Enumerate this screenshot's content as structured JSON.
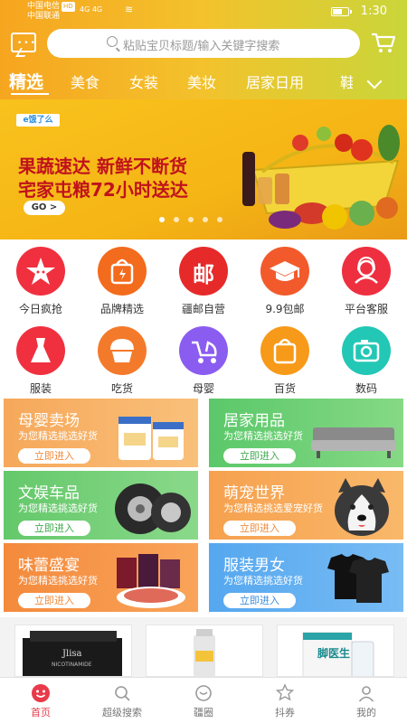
{
  "status": {
    "carrier1": "中国电信",
    "carrier1_badge": "HD",
    "carrier2": "中国联通",
    "signal": "4G 4G",
    "wifi": "≋",
    "time": "1:30"
  },
  "search": {
    "placeholder": "粘贴宝贝标题/输入关键字搜索"
  },
  "categories": [
    "精选",
    "美食",
    "女装",
    "美妆",
    "居家日用",
    "鞋"
  ],
  "banner": {
    "brand": "e饿了么",
    "headline1": "果蔬速达  新鲜不断货",
    "headline2": "宅家屯粮72小时送达",
    "button": "GO >",
    "dots": 5,
    "active_dot": 0
  },
  "grid": [
    {
      "label": "今日疯抢",
      "icon": "star-face-icon",
      "color": "#f0303f"
    },
    {
      "label": "品牌精选",
      "icon": "shopping-bag-bolt-icon",
      "color": "#f36b1c"
    },
    {
      "label": "疆邮自营",
      "icon": "mail-char-icon",
      "color": "#e62a2a",
      "glyph": "邮"
    },
    {
      "label": "9.9包邮",
      "icon": "graduation-cap-icon",
      "color": "#f25a2c"
    },
    {
      "label": "平台客服",
      "icon": "customer-service-icon",
      "color": "#ee2f3f"
    },
    {
      "label": "服装",
      "icon": "dress-icon",
      "color": "#f0303f"
    },
    {
      "label": "吃货",
      "icon": "cupcake-icon",
      "color": "#f47a2b"
    },
    {
      "label": "母婴",
      "icon": "stroller-icon",
      "color": "#8b5cf0"
    },
    {
      "label": "百货",
      "icon": "shopping-bag-icon",
      "color": "#f79a1a"
    },
    {
      "label": "数码",
      "icon": "camera-icon",
      "color": "#22c7b5"
    }
  ],
  "cards": [
    {
      "title": "母婴卖场",
      "subtitle": "为您精选挑选好货",
      "button": "立即进入",
      "bg": "#f6a85a",
      "btn_color": "#f08a3a",
      "art": "milk-formula-cans"
    },
    {
      "title": "居家用品",
      "subtitle": "为您精选挑选好货",
      "button": "立即进入",
      "bg": "#5bc86a",
      "btn_color": "#3daa4d",
      "art": "sofa"
    },
    {
      "title": "文娱车品",
      "subtitle": "为您精选挑选好货",
      "button": "立即进入",
      "bg": "#64c86a",
      "btn_color": "#3daa4d",
      "art": "tires"
    },
    {
      "title": "萌宠世界",
      "subtitle": "为您精选挑选爱宠好货",
      "button": "立即进入",
      "bg": "#f6a14f",
      "btn_color": "#f08a3a",
      "art": "husky-dog"
    },
    {
      "title": "味蕾盛宴",
      "subtitle": "为您精选挑选好货",
      "button": "立即进入",
      "bg": "#f48a3c",
      "btn_color": "#f08a3a",
      "art": "snack-packs"
    },
    {
      "title": "服装男女",
      "subtitle": "为您精选挑选好货",
      "button": "立即进入",
      "bg": "#55a7ef",
      "btn_color": "#3a8ddf",
      "art": "tshirts"
    }
  ],
  "products": [
    {
      "name": "Jlisa",
      "caption": "NICOTINAMIDE"
    },
    {
      "name": "",
      "caption": ""
    },
    {
      "name": "脚医生",
      "caption": ""
    }
  ],
  "tabs": [
    {
      "label": "首页",
      "icon": "home-face-icon",
      "active": true
    },
    {
      "label": "超级搜索",
      "icon": "search-icon",
      "active": false
    },
    {
      "label": "疆圈",
      "icon": "circle-icon",
      "active": false
    },
    {
      "label": "抖券",
      "icon": "coupon-icon",
      "active": false
    },
    {
      "label": "我的",
      "icon": "user-icon",
      "active": false
    }
  ]
}
